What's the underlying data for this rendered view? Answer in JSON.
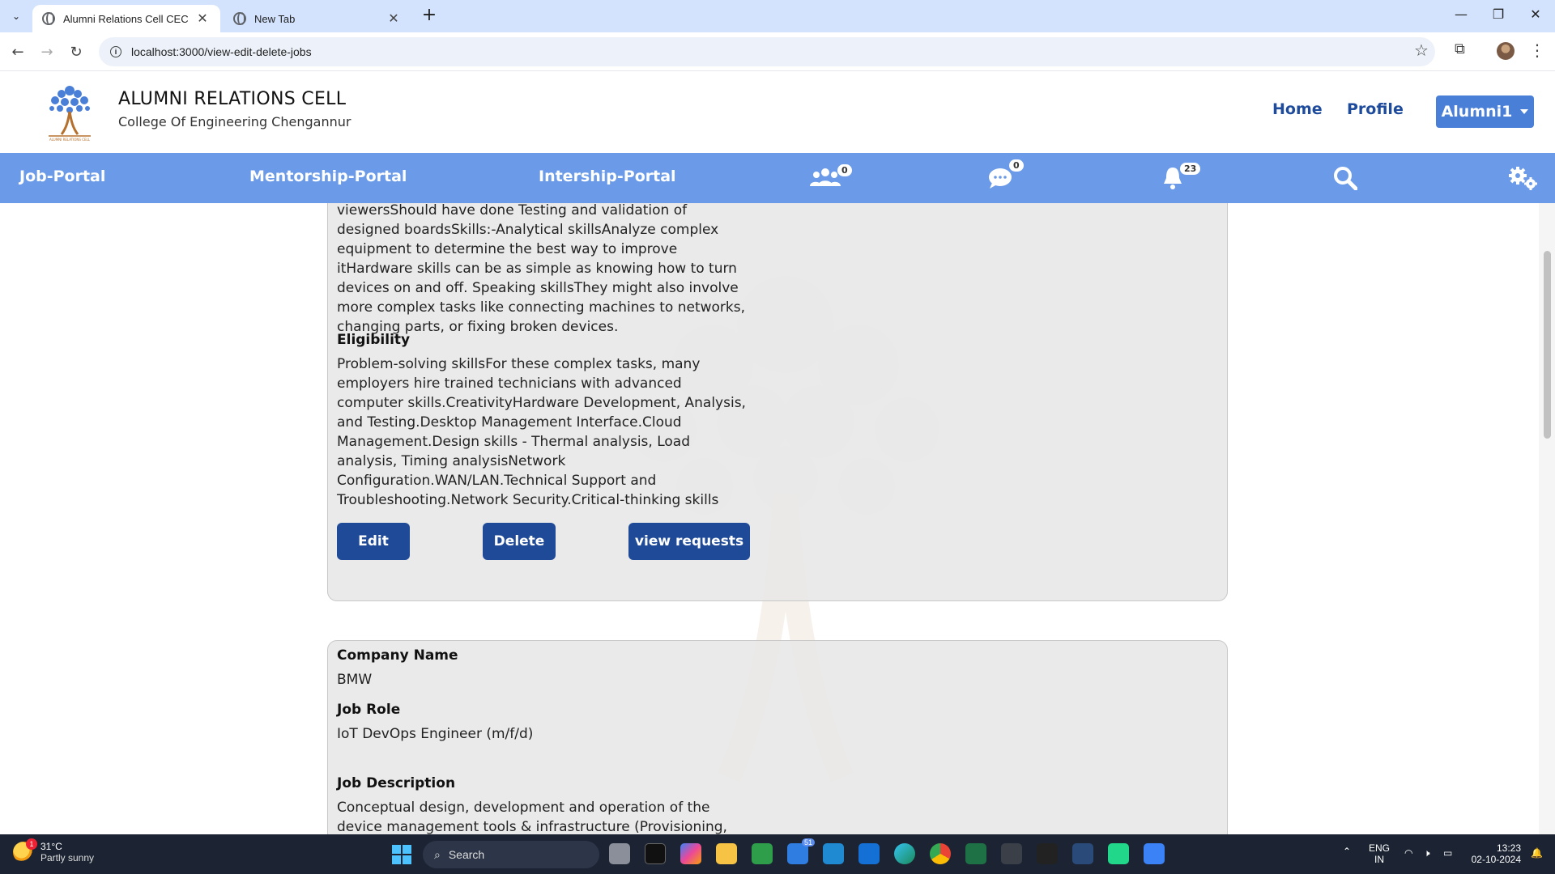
{
  "browser": {
    "tabs": [
      {
        "title": "Alumni Relations Cell CEC",
        "active": true
      },
      {
        "title": "New Tab",
        "active": false
      }
    ],
    "url": "localhost:3000/view-edit-delete-jobs"
  },
  "header": {
    "title": "ALUMNI RELATIONS CELL",
    "subtitle": "College Of Engineering Chengannur",
    "links": [
      "Home",
      "Profile"
    ],
    "user_button": "Alumni1"
  },
  "portal_nav": {
    "items": [
      "Job-Portal",
      "Mentorship-Portal",
      "Intership-Portal"
    ],
    "badges": {
      "groups": "0",
      "messages": "0",
      "notifications": "23"
    }
  },
  "job1": {
    "desc_partial": "viewersShould have done Testing and validation of designed boardsSkills:-Analytical skillsAnalyze complex equipment to determine the best way to improve itHardware skills can be as simple as knowing how to turn devices on and off. Speaking skillsThey might also involve more complex tasks like connecting machines to networks, changing parts, or fixing broken devices.",
    "eligibility_label": "Eligibility",
    "eligibility": "Problem-solving skillsFor these complex tasks, many employers hire trained technicians with advanced computer skills.CreativityHardware Development, Analysis, and Testing.Desktop Management Interface.Cloud Management.Design skills - Thermal analysis, Load analysis, Timing analysisNetwork Configuration.WAN/LAN.Technical Support and Troubleshooting.Network Security.Critical-thinking skills",
    "buttons": {
      "edit": "Edit",
      "delete": "Delete",
      "view_requests": "view requests"
    }
  },
  "job2": {
    "company_label": "Company Name",
    "company": "BMW",
    "role_label": "Job Role",
    "role": "IoT DevOps Engineer (m/f/d)",
    "desc_label": "Job Description",
    "desc_partial": "Conceptual design, development and operation of the device management tools & infrastructure (Provisioning, Remote"
  },
  "taskbar": {
    "weather_temp": "31°C",
    "weather_desc": "Partly sunny",
    "weather_badge": "1",
    "search": "Search",
    "lang1": "ENG",
    "lang2": "IN",
    "time": "13:23",
    "date": "02-10-2024",
    "mail_badge": "51"
  }
}
